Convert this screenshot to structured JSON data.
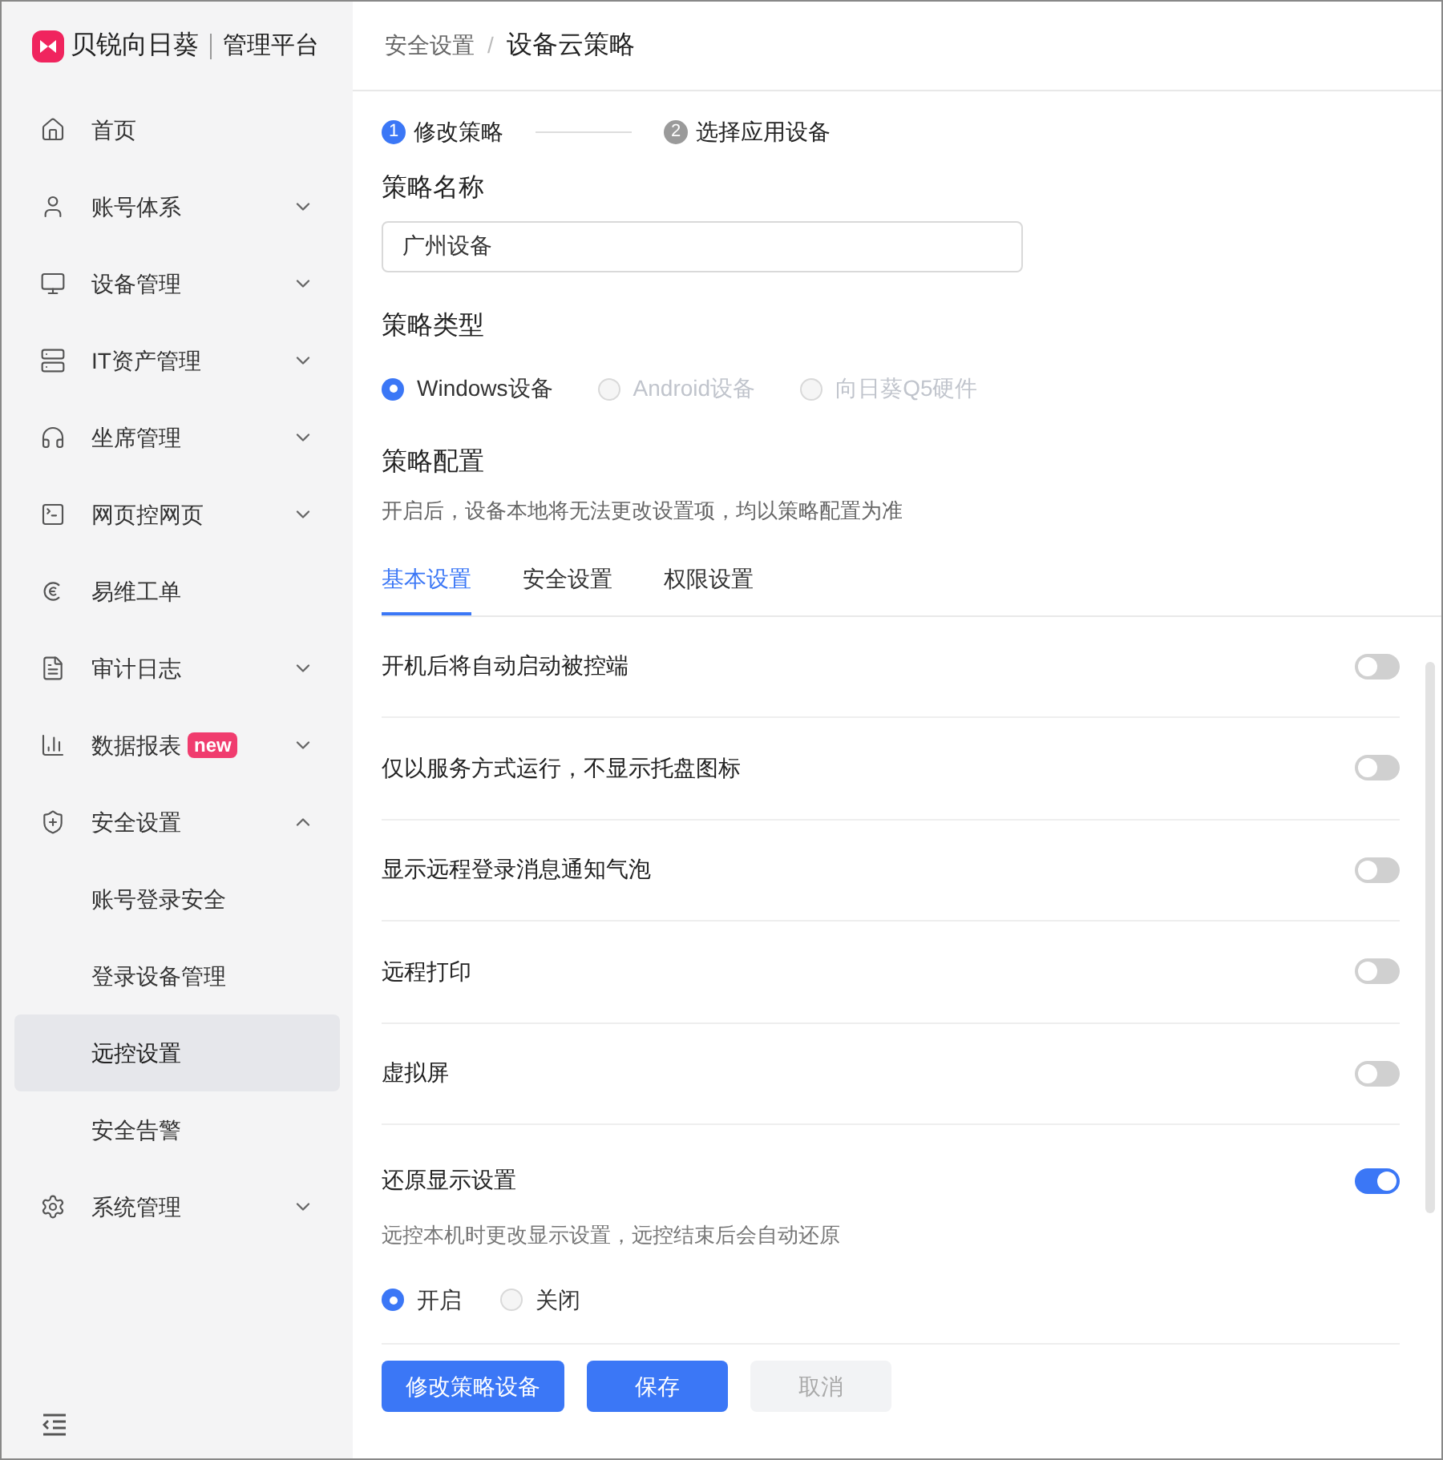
{
  "logo": {
    "brand": "贝锐向日葵",
    "product": "管理平台"
  },
  "sidebar": {
    "items": [
      {
        "label": "首页"
      },
      {
        "label": "账号体系",
        "expanded": false
      },
      {
        "label": "设备管理",
        "expanded": false
      },
      {
        "label": "IT资产管理",
        "expanded": false
      },
      {
        "label": "坐席管理",
        "expanded": false
      },
      {
        "label": "网页控网页",
        "expanded": false
      },
      {
        "label": "易维工单"
      },
      {
        "label": "审计日志",
        "expanded": false
      },
      {
        "label": "数据报表",
        "badge": "new",
        "expanded": false
      },
      {
        "label": "安全设置",
        "expanded": true,
        "children": [
          {
            "label": "账号登录安全",
            "selected": false
          },
          {
            "label": "登录设备管理",
            "selected": false
          },
          {
            "label": "远控设置",
            "selected": true
          },
          {
            "label": "安全告警",
            "selected": false
          }
        ]
      },
      {
        "label": "系统管理",
        "expanded": false
      }
    ]
  },
  "breadcrumb": [
    "安全设置",
    "设备云策略"
  ],
  "breadcrumb_separator": "/",
  "steps": [
    {
      "number": "1",
      "label": "修改策略",
      "selected": true
    },
    {
      "number": "2",
      "label": "选择应用设备",
      "selected": false
    }
  ],
  "name_field": {
    "label": "策略名称",
    "value": "广州设备"
  },
  "type_field": {
    "label": "策略类型",
    "options": [
      {
        "label": "Windows设备",
        "selected": true,
        "disabled": false
      },
      {
        "label": "Android设备",
        "selected": false,
        "disabled": true
      },
      {
        "label": "向日葵Q5硬件",
        "selected": false,
        "disabled": true
      }
    ]
  },
  "config": {
    "title": "策略配置",
    "description": "开启后，设备本地将无法更改设置项，均以策略配置为准"
  },
  "tabs": [
    {
      "label": "基本设置",
      "selected": true
    },
    {
      "label": "安全设置",
      "selected": false
    },
    {
      "label": "权限设置",
      "selected": false
    }
  ],
  "settings": [
    {
      "label": "开机后将自动启动被控端",
      "on": false
    },
    {
      "label": "仅以服务方式运行，不显示托盘图标",
      "on": false
    },
    {
      "label": "显示远程登录消息通知气泡",
      "on": false
    },
    {
      "label": "远程打印",
      "on": false
    },
    {
      "label": "虚拟屏",
      "on": false
    },
    {
      "label": "还原显示设置",
      "on": true,
      "description": "远控本机时更改显示设置，远控结束后会自动还原",
      "options": [
        {
          "label": "开启",
          "selected": true
        },
        {
          "label": "关闭",
          "selected": false
        }
      ]
    }
  ],
  "buttons": [
    {
      "label": "修改策略设备",
      "kind": "primary"
    },
    {
      "label": "保存",
      "kind": "primary"
    },
    {
      "label": "取消",
      "kind": "disabled"
    }
  ]
}
